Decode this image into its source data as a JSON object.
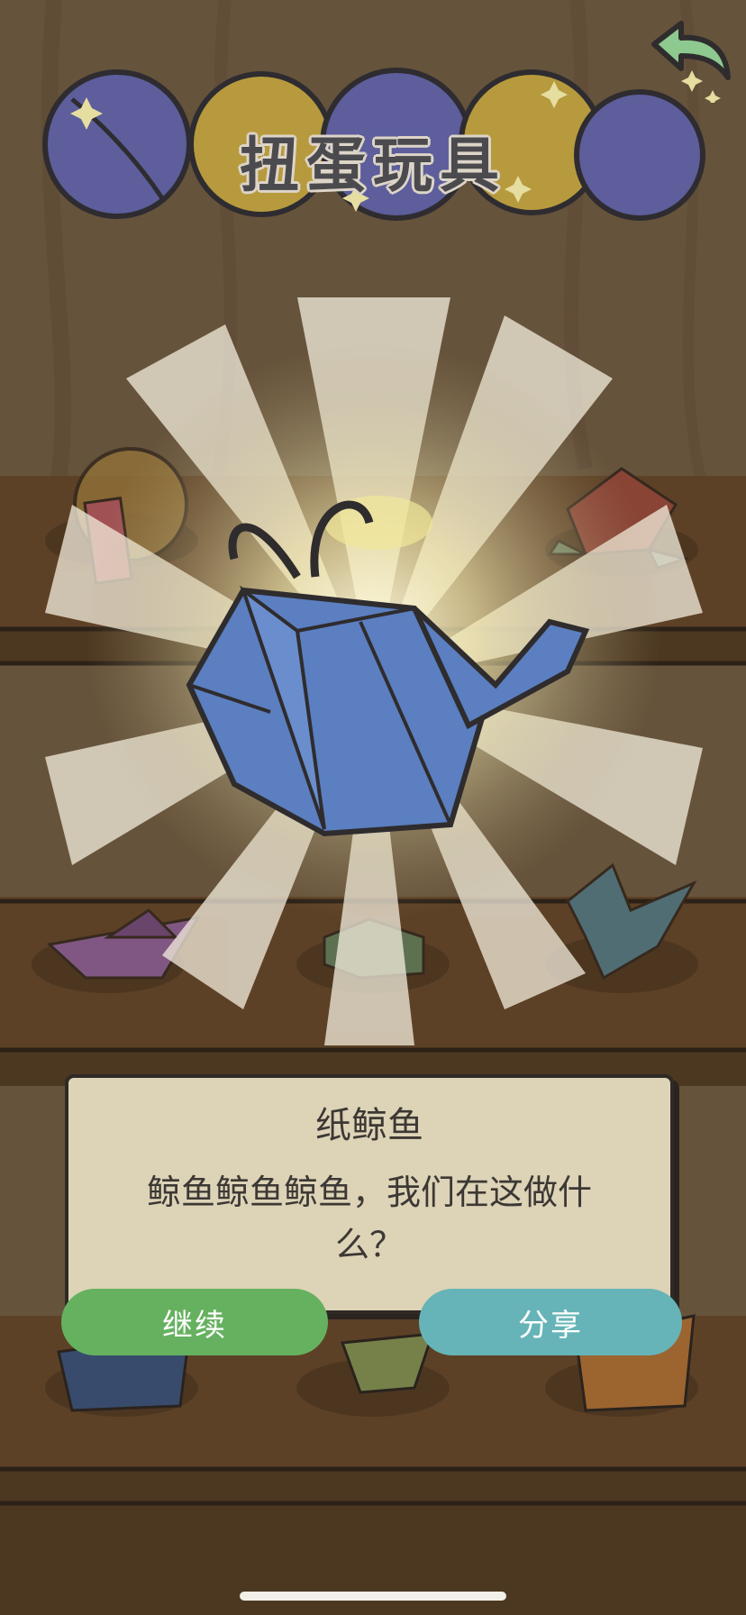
{
  "screen": {
    "title": "扭蛋玩具"
  },
  "dialog": {
    "item_name": "纸鲸鱼",
    "description": "鲸鱼鲸鱼鲸鱼，我们在这做什么？"
  },
  "buttons": {
    "continue_label": "继续",
    "share_label": "分享"
  },
  "icons": {
    "back": "back-arrow-icon"
  },
  "colors": {
    "continue_button": "#66b15f",
    "share_button": "#66b4b7",
    "dialog_background": "#ddd3b7",
    "whale": "#5b7fc0"
  },
  "shelf_items": [
    "orange-charm",
    "banana",
    "origami-rose",
    "origami-boat",
    "origami-frog",
    "origami-crane",
    "origami-blue-figure",
    "origami-green-figure",
    "origami-orange-figure"
  ]
}
